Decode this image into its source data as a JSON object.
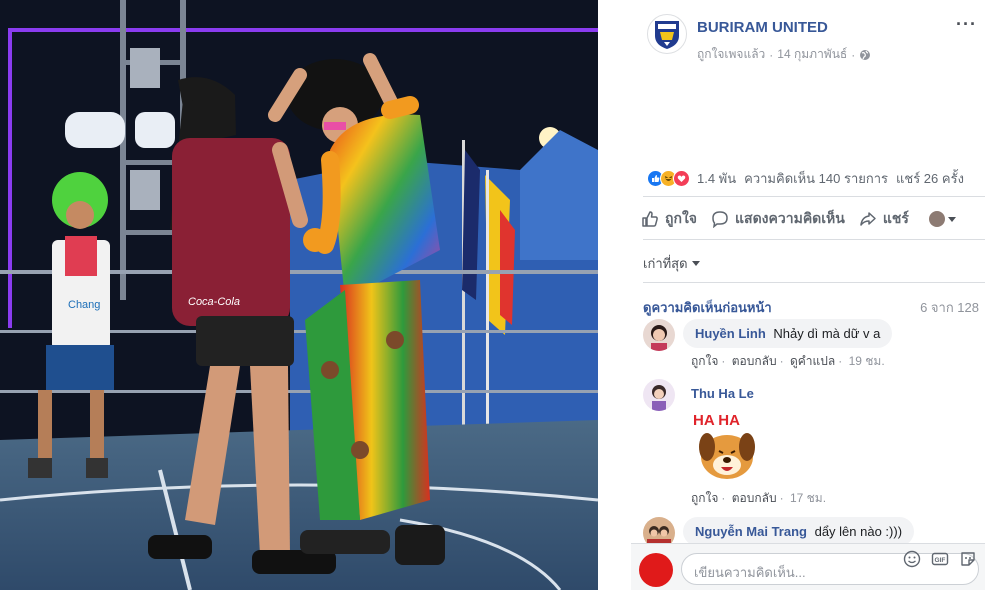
{
  "post": {
    "page_name": "BURIRAM UNITED",
    "liked_status": "ถูกใจเพจแล้ว",
    "date": "14 กุมภาพันธ์",
    "separator": "·",
    "more_label": "···"
  },
  "photo": {
    "sign_text": "Chang",
    "shirt_text": "Coca-Cola",
    "bib_text": "Chang"
  },
  "engagement": {
    "reaction_count": "1.4 พัน",
    "comment_count": "ความคิดเห็น 140 รายการ",
    "share_count": "แชร์ 26 ครั้ง",
    "reaction_colors": {
      "like": "#1877f2",
      "haha": "#f7b125",
      "love": "#f33e58"
    }
  },
  "actions": {
    "like": "ถูกใจ",
    "comment": "แสดงความคิดเห็น",
    "share": "แชร์"
  },
  "comments_section": {
    "sort_label": "เก่าที่สุด",
    "view_previous": "ดูความคิดเห็นก่อนหน้า",
    "count_label": "6 จาก 128",
    "items": [
      {
        "author": "Huyền Linh",
        "text": "Nhảy dì mà dữ v a",
        "like": "ถูกใจ",
        "reply": "ตอบกลับ",
        "translate": "ดูคำแปล",
        "time": "19 ชม."
      },
      {
        "author": "Thu Ha Le",
        "sticker_text": "HA HA",
        "like": "ถูกใจ",
        "reply": "ตอบกลับ",
        "time": "17 ชม."
      },
      {
        "author": "Nguyễn Mai Trang",
        "text": "dẩy lên nào :)))"
      }
    ]
  },
  "composer": {
    "placeholder": "เขียนความคิดเห็น...",
    "gif_label": "GIF"
  }
}
